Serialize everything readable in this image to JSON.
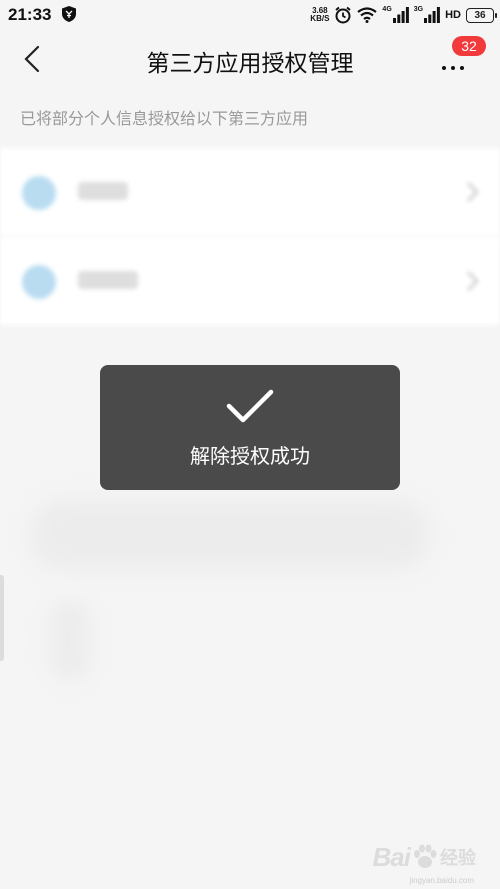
{
  "status_bar": {
    "time": "21:33",
    "speed_value": "3.68",
    "speed_unit": "KB/S",
    "net1": "4G",
    "net2": "3G",
    "hd": "HD",
    "battery": "36"
  },
  "nav": {
    "title": "第三方应用授权管理",
    "badge_count": "32"
  },
  "subtitle": "已将部分个人信息授权给以下第三方应用",
  "toast": {
    "message": "解除授权成功"
  },
  "watermark": {
    "brand": "Bai",
    "suffix": "经验",
    "url": "jingyan.baidu.com"
  },
  "colors": {
    "badge": "#f2393b",
    "toast_bg": "#3c3c3c",
    "app_icon": "#b9dcf1"
  },
  "icons": [
    "shield-icon",
    "alarm-icon",
    "wifi-icon",
    "signal-icon",
    "back-arrow-icon",
    "more-icon",
    "chevron-right-icon",
    "check-icon",
    "paw-icon"
  ]
}
